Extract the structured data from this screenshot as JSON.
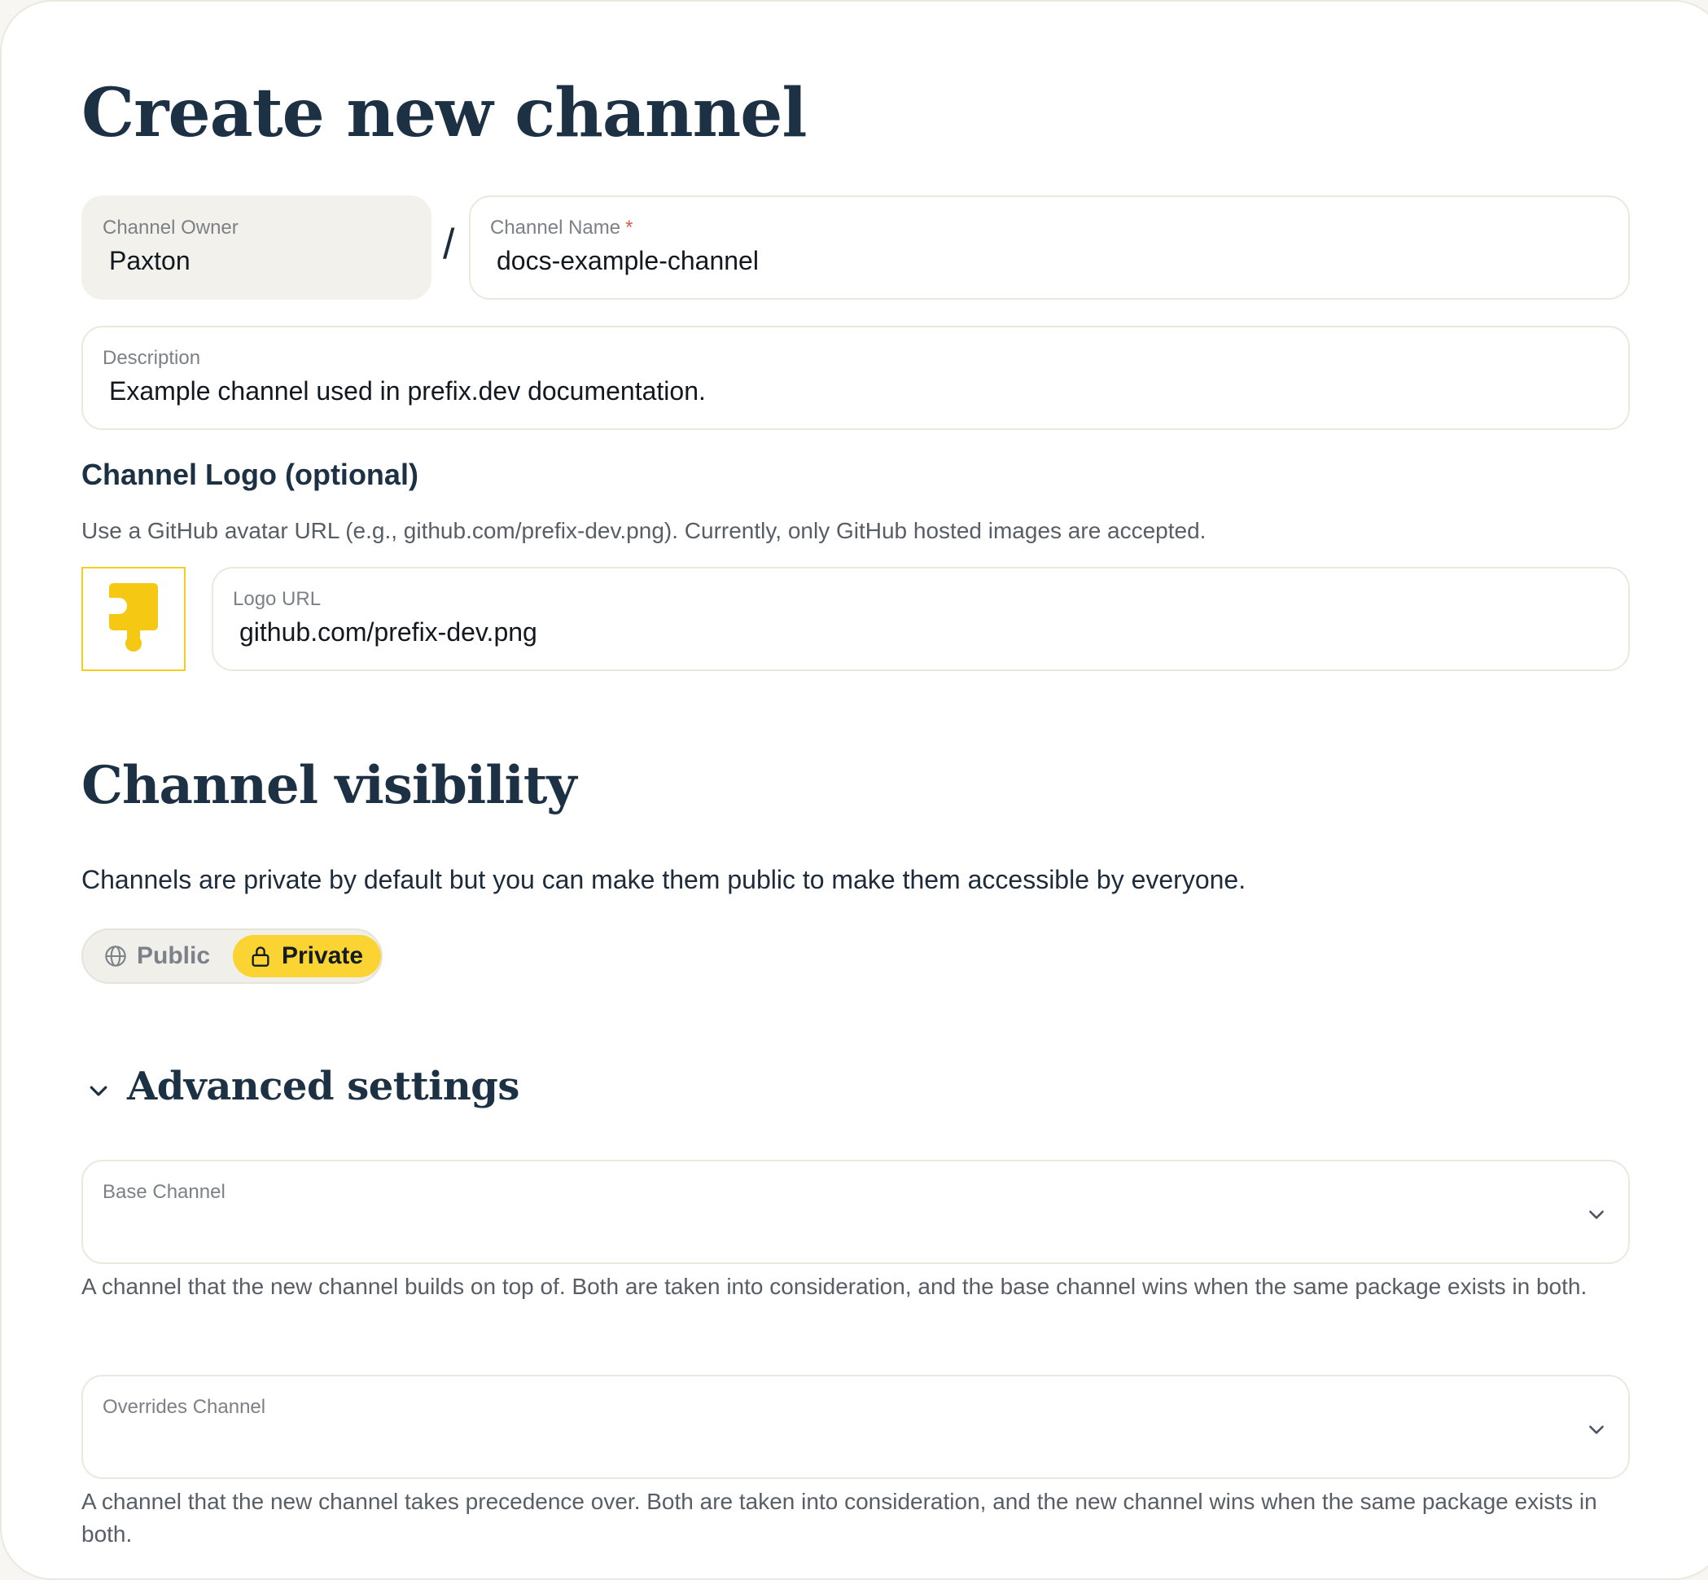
{
  "page": {
    "title": "Create new channel"
  },
  "owner": {
    "label": "Channel Owner",
    "value": "Paxton"
  },
  "separator": "/",
  "channel_name": {
    "label": "Channel Name",
    "required_mark": "*",
    "value": "docs-example-channel"
  },
  "description": {
    "label": "Description",
    "value": "Example channel used in prefix.dev documentation."
  },
  "logo": {
    "heading": "Channel Logo (optional)",
    "help": "Use a GitHub avatar URL (e.g., github.com/prefix-dev.png). Currently, only GitHub hosted images are accepted.",
    "url_label": "Logo URL",
    "url_value": "github.com/prefix-dev.png",
    "preview_icon": "prefix-logo-icon",
    "accent_color": "#f5c814"
  },
  "visibility": {
    "heading": "Channel visibility",
    "text": "Channels are private by default but you can make them public to make them accessible by everyone.",
    "options": [
      {
        "label": "Public",
        "icon": "globe-icon",
        "selected": false
      },
      {
        "label": "Private",
        "icon": "lock-icon",
        "selected": true
      }
    ],
    "selected_color": "#fbd332"
  },
  "advanced": {
    "heading": "Advanced settings",
    "expanded": true,
    "base_channel": {
      "label": "Base Channel",
      "value": "",
      "help": "A channel that the new channel builds on top of. Both are taken into consideration, and the base channel wins when the same package exists in both."
    },
    "overrides_channel": {
      "label": "Overrides Channel",
      "value": "",
      "help": "A channel that the new channel takes precedence over. Both are taken into consideration, and the new channel wins when the same package exists in both."
    }
  }
}
